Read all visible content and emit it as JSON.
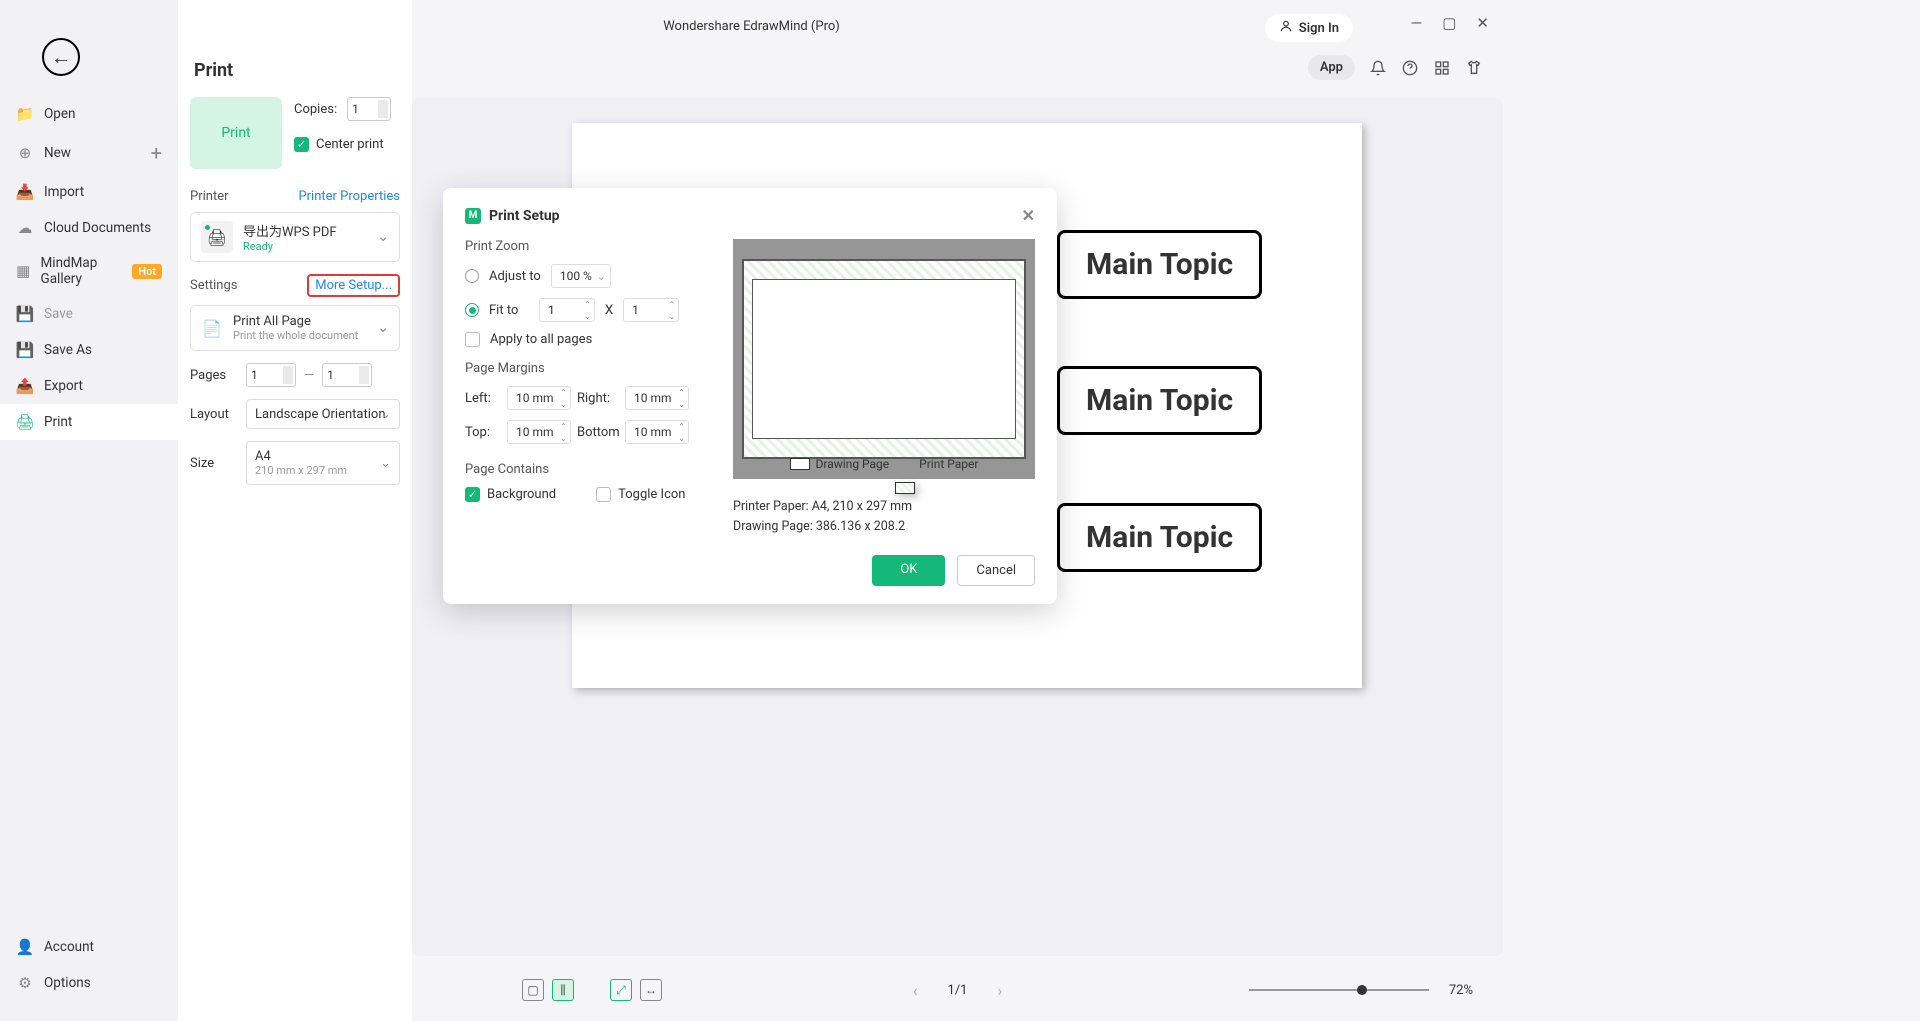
{
  "app_title": "Wondershare EdrawMind (Pro)",
  "signin": "Sign In",
  "toolbar": {
    "app_badge": "App"
  },
  "sidebar": {
    "open": "Open",
    "new": "New",
    "import": "Import",
    "cloud": "Cloud Documents",
    "gallery": "MindMap Gallery",
    "hot": "Hot",
    "save": "Save",
    "saveas": "Save As",
    "export": "Export",
    "print": "Print",
    "account": "Account",
    "options": "Options"
  },
  "print_panel": {
    "title": "Print",
    "big_print": "Print",
    "copies_label": "Copies:",
    "copies_value": "1",
    "center_print": "Center print",
    "printer_label": "Printer",
    "printer_props": "Printer Properties",
    "printer_name": "导出为WPS PDF",
    "printer_status": "Ready",
    "settings_label": "Settings",
    "more_setup": "More Setup...",
    "print_all_title": "Print All Page",
    "print_all_sub": "Print the whole document",
    "pages_label": "Pages",
    "pages_from": "1",
    "pages_to": "1",
    "layout_label": "Layout",
    "layout_value": "Landscape Orientation",
    "size_label": "Size",
    "size_value": "A4",
    "size_sub": "210 mm x 297 mm"
  },
  "dialog": {
    "title": "Print Setup",
    "zoom_label": "Print Zoom",
    "adjust_to": "Adjust to",
    "adjust_value": "100 %",
    "fit_to": "Fit to",
    "fit_w": "1",
    "x": "X",
    "fit_h": "1",
    "apply_all": "Apply to all pages",
    "margins_label": "Page Margins",
    "left": "Left:",
    "left_v": "10 mm",
    "right": "Right:",
    "right_v": "10 mm",
    "top": "Top:",
    "top_v": "10 mm",
    "bottom": "Bottom",
    "bottom_v": "10 mm",
    "contains_label": "Page Contains",
    "background": "Background",
    "toggle_icon": "Toggle Icon",
    "drawing_page": "Drawing Page",
    "print_paper": "Print Paper",
    "printer_paper_info": "Printer Paper: A4, 210 x 297 mm",
    "drawing_page_info": "Drawing Page: 386.136 x 208.2",
    "ok": "OK",
    "cancel": "Cancel"
  },
  "canvas": {
    "topic": "Main Topic"
  },
  "bottom_bar": {
    "page_indicator": "1/1",
    "zoom": "72%"
  }
}
